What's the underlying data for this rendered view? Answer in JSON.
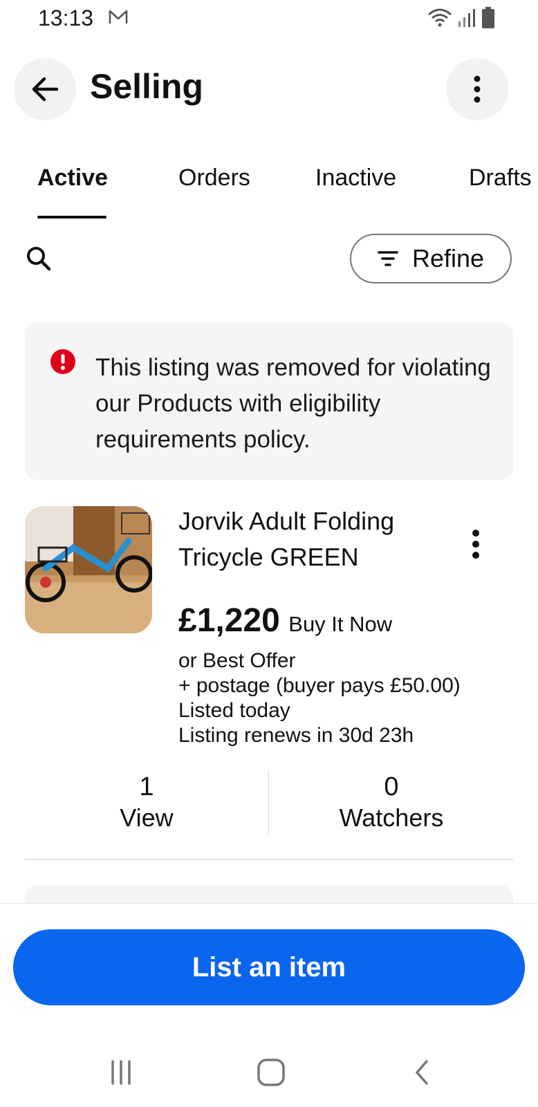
{
  "status_bar": {
    "time": "13:13",
    "icons": [
      "mail-icon",
      "wifi-icon",
      "signal-icon",
      "battery-icon"
    ]
  },
  "header": {
    "title": "Selling",
    "back_icon": "arrow-left-icon",
    "menu_icon": "more-vertical-icon"
  },
  "tabs": [
    {
      "label": "Active",
      "active": true
    },
    {
      "label": "Orders",
      "active": false
    },
    {
      "label": "Inactive",
      "active": false
    },
    {
      "label": "Drafts",
      "active": false
    }
  ],
  "toolbar": {
    "search_icon": "search-icon",
    "refine_label": "Refine"
  },
  "alert": {
    "icon": "error-icon",
    "message": "This listing was removed for violating our Products with eligibility requirements policy."
  },
  "listing": {
    "title": "Jorvik Adult Folding Tricycle GREEN",
    "price": "£1,220",
    "format": "Buy It Now",
    "offer": "or Best Offer",
    "postage": "+ postage (buyer pays £50.00)",
    "listed": "Listed today",
    "renews": "Listing renews in 30d 23h",
    "stats": [
      {
        "value": "1",
        "label": "View"
      },
      {
        "value": "0",
        "label": "Watchers"
      }
    ]
  },
  "footer": {
    "primary_button": "List an item"
  },
  "nav_bar": [
    "recent-apps-icon",
    "home-icon",
    "back-icon"
  ],
  "colors": {
    "primary_button": "#0a66ee",
    "alert_icon": "#e0001b",
    "alert_background": "#f5f5f5"
  }
}
